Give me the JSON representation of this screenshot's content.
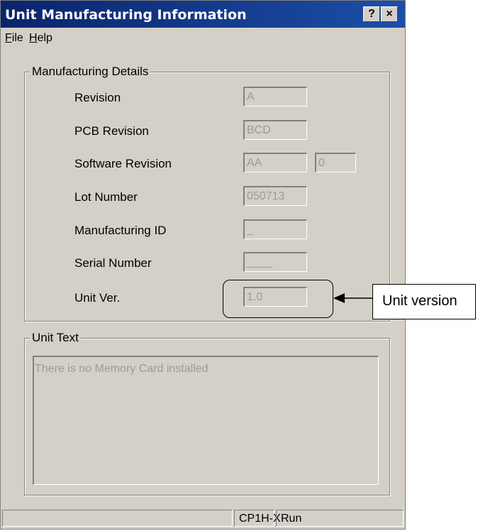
{
  "window": {
    "title": "Unit Manufacturing Information",
    "help_button": "?",
    "close_button": "×"
  },
  "menu": {
    "file": "File",
    "help": "Help"
  },
  "manufacturing_details": {
    "legend": "Manufacturing Details",
    "fields": [
      {
        "label": "Revision",
        "value": "A"
      },
      {
        "label": "PCB Revision",
        "value": "BCD"
      },
      {
        "label": "Software Revision",
        "value": "AA",
        "extra_value": "0"
      },
      {
        "label": "Lot Number",
        "value": "050713"
      },
      {
        "label": "Manufacturing ID",
        "value": "_"
      },
      {
        "label": "Serial Number",
        "value": "____"
      },
      {
        "label": "Unit Ver.",
        "value": "1.0"
      }
    ]
  },
  "unit_text": {
    "legend": "Unit Text",
    "content": "There is no Memory Card installed"
  },
  "status_bar": {
    "panels": [
      "",
      "CP1H-X",
      "Run"
    ]
  },
  "annotation": {
    "callout": "Unit version"
  }
}
